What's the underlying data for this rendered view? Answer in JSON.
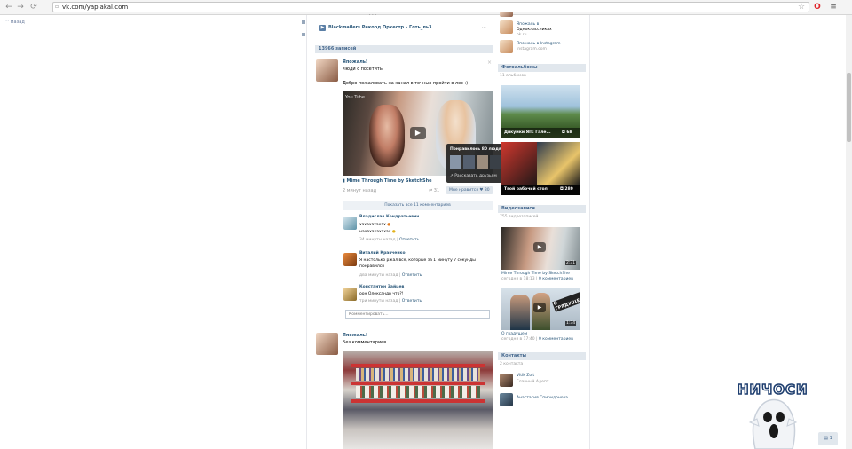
{
  "browser": {
    "url": "vk.com/yaplakal.com"
  },
  "back_link": "Назад",
  "post_top_audio": "Blackmailers Рекорд Оркестр – Готь_ль3",
  "wall_count": "13966 записей",
  "post1": {
    "author": "Япожаль!",
    "subtitle": "Люди с посетить",
    "text": "Добро пожаловать на канал в точных пройти в лес :)",
    "video_title": "Mime Through Time by SketchShe",
    "time": "2 минут назад",
    "likes_count": "31",
    "liked_label": "Мне нравится",
    "likes_num": "80",
    "popup_title": "Понравилось 80 людям",
    "popup_share": "Рассказать друзьям",
    "comments_bar": "Показать все 11 комментариев",
    "comments": [
      {
        "author": "Владислав Кондратьевич",
        "text": "хахахахахах",
        "text2": "нахахахахахах",
        "meta": "34 минуты назад",
        "reply": "Ответить"
      },
      {
        "author": "Виталий Кравченко",
        "text": "Я настолько ржал все, которые за 1 минуту 7 секунды",
        "text2": "понравился",
        "meta": "два минуты назад",
        "reply": "Ответить"
      },
      {
        "author": "Константин Зайцев",
        "text": "оон Олександр что?!",
        "text2": "",
        "meta": "три минуты назад",
        "reply": "Ответить"
      }
    ],
    "comment_placeholder": "Комментировать..."
  },
  "post2": {
    "author": "Япожаль!",
    "subtitle": "Без комментариев"
  },
  "right": {
    "top_items": [
      {
        "name": "Япожаль в",
        "sub": "Одноклассниках"
      },
      {
        "name": "",
        "sub": "ok.ru"
      },
      {
        "name": "Япожаль в Instagram",
        "sub": "instagram.com"
      }
    ],
    "photos_header": "Фотоальбомы",
    "photos_count": "11 альбомов",
    "photo_cards": [
      {
        "caption": "Дикумки ЯП: Гале...",
        "count": "68"
      },
      {
        "caption": "Твой рабочий стол",
        "count": "280"
      }
    ],
    "videos_header": "Видеозаписи",
    "videos_count": "755 видеозаписей",
    "video_cards": [
      {
        "duration": "2:31",
        "title": "Mime Through Time by SketchShe",
        "meta": "сегодня в 18:13",
        "comments": "0 комментариев"
      },
      {
        "duration": "1:34",
        "title": "О градущем",
        "meta": "сегодня в 17:40",
        "comments": "0 комментариев",
        "overlay": "О ГРЯДУЩЕМ"
      }
    ],
    "contacts_header": "Контакты",
    "contacts_count": "2 контакта",
    "contacts": [
      {
        "name": "Vitik Zolt",
        "role": "Главный Адепт"
      },
      {
        "name": "Анастасия Спиридонова",
        "role": ""
      }
    ]
  },
  "sticker_text": "НИЧОСИ",
  "bottom_right_badge": "1"
}
